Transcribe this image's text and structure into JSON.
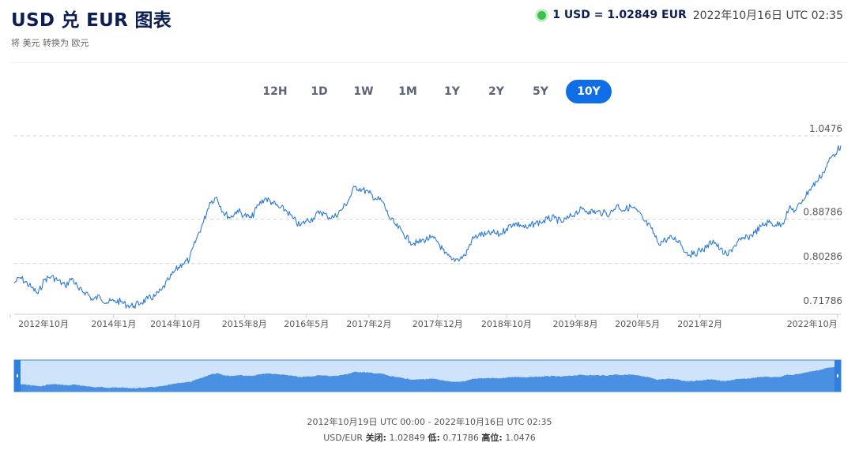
{
  "header": {
    "title": "USD 兑 EUR 图表",
    "subtitle": "将 美元 转换为 欧元",
    "rate": "1 USD = 1.02849 EUR",
    "timestamp": "2022年10月16日 UTC 02:35",
    "live_color": "#3ec14a"
  },
  "tabs": [
    "12H",
    "1D",
    "1W",
    "1M",
    "1Y",
    "2Y",
    "5Y",
    "10Y"
  ],
  "active_tab": "10Y",
  "footer": {
    "range": "2012年10月19日 UTC 00:00 - 2022年10月16日 UTC 02:35",
    "pair": "USD/EUR",
    "close_label": "关闭:",
    "close_value": "1.02849",
    "low_label": "低:",
    "low_value": "0.71786",
    "high_label": "高位:",
    "high_value": "1.0476"
  },
  "colors": {
    "line": "#2b7ad7",
    "navigator_fill": "#4a90e2",
    "navigator_bg": "#cfe3fb",
    "accent": "#0f6de8"
  },
  "chart_data": {
    "type": "line",
    "title": "",
    "xlabel": "",
    "ylabel": "",
    "ylim": [
      0.71786,
      1.0476
    ],
    "yticks": [
      0.71786,
      0.80286,
      0.88786,
      1.0476
    ],
    "ytick_labels": [
      "0.71786",
      "0.80286",
      "0.88786",
      "1.0476"
    ],
    "xlim": [
      "2012-10-19",
      "2022-10-16"
    ],
    "xticks": [
      "2012-10-01",
      "2014-01-01",
      "2014-10-01",
      "2015-08-01",
      "2016-05-01",
      "2017-02-01",
      "2017-12-01",
      "2018-10-01",
      "2019-08-01",
      "2020-05-01",
      "2021-02-01",
      "2022-10-01"
    ],
    "xtick_labels": [
      "2012年10月",
      "2014年1月",
      "2014年10月",
      "2015年8月",
      "2016年5月",
      "2017年2月",
      "2017年12月",
      "2018年10月",
      "2019年8月",
      "2020年5月",
      "2021年2月",
      "2022年10月"
    ],
    "grid": "horizontal dashed",
    "legend": "none",
    "series": [
      {
        "x": [
          "2012-10-19",
          "2012-11-15",
          "2013-01-01",
          "2013-02-01",
          "2013-03-01",
          "2013-04-01",
          "2013-05-01",
          "2013-06-01",
          "2013-07-01",
          "2013-08-01",
          "2013-09-01",
          "2013-10-01",
          "2013-11-01",
          "2013-12-01",
          "2014-01-01",
          "2014-02-01",
          "2014-03-01",
          "2014-04-01",
          "2014-05-01",
          "2014-06-01",
          "2014-07-01",
          "2014-08-01",
          "2014-09-01",
          "2014-10-01",
          "2014-11-01",
          "2014-12-01",
          "2015-01-01",
          "2015-02-01",
          "2015-03-01",
          "2015-04-01",
          "2015-05-01",
          "2015-06-01",
          "2015-07-01",
          "2015-08-01",
          "2015-09-01",
          "2015-10-01",
          "2015-11-01",
          "2015-12-01",
          "2016-01-01",
          "2016-02-01",
          "2016-03-01",
          "2016-04-01",
          "2016-05-01",
          "2016-06-01",
          "2016-07-01",
          "2016-08-01",
          "2016-09-01",
          "2016-10-01",
          "2016-11-01",
          "2016-12-01",
          "2017-01-01",
          "2017-02-01",
          "2017-03-01",
          "2017-04-01",
          "2017-05-01",
          "2017-06-01",
          "2017-07-01",
          "2017-08-01",
          "2017-09-01",
          "2017-10-01",
          "2017-11-01",
          "2017-12-01",
          "2018-01-01",
          "2018-02-01",
          "2018-03-01",
          "2018-04-01",
          "2018-05-01",
          "2018-06-01",
          "2018-07-01",
          "2018-08-01",
          "2018-09-01",
          "2018-10-01",
          "2018-11-01",
          "2018-12-01",
          "2019-01-01",
          "2019-02-01",
          "2019-03-01",
          "2019-04-01",
          "2019-05-01",
          "2019-06-01",
          "2019-07-01",
          "2019-08-01",
          "2019-09-01",
          "2019-10-01",
          "2019-11-01",
          "2019-12-01",
          "2020-01-01",
          "2020-02-01",
          "2020-03-01",
          "2020-04-01",
          "2020-05-01",
          "2020-06-01",
          "2020-07-01",
          "2020-08-01",
          "2020-09-01",
          "2020-10-01",
          "2020-11-01",
          "2020-12-01",
          "2021-01-01",
          "2021-02-01",
          "2021-03-01",
          "2021-04-01",
          "2021-05-01",
          "2021-06-01",
          "2021-07-01",
          "2021-08-01",
          "2021-09-01",
          "2021-10-01",
          "2021-11-01",
          "2021-12-01",
          "2022-01-01",
          "2022-02-01",
          "2022-03-01",
          "2022-04-01",
          "2022-05-01",
          "2022-06-01",
          "2022-07-01",
          "2022-08-01",
          "2022-09-01",
          "2022-10-01",
          "2022-10-16"
        ],
        "y": [
          0.766,
          0.776,
          0.758,
          0.745,
          0.772,
          0.778,
          0.77,
          0.76,
          0.775,
          0.752,
          0.748,
          0.733,
          0.74,
          0.728,
          0.731,
          0.73,
          0.723,
          0.722,
          0.728,
          0.735,
          0.74,
          0.752,
          0.772,
          0.79,
          0.803,
          0.81,
          0.85,
          0.882,
          0.92,
          0.93,
          0.9,
          0.891,
          0.905,
          0.895,
          0.89,
          0.915,
          0.928,
          0.92,
          0.91,
          0.905,
          0.89,
          0.875,
          0.885,
          0.89,
          0.903,
          0.893,
          0.892,
          0.905,
          0.923,
          0.95,
          0.945,
          0.938,
          0.928,
          0.922,
          0.892,
          0.875,
          0.862,
          0.845,
          0.842,
          0.848,
          0.852,
          0.845,
          0.822,
          0.81,
          0.812,
          0.818,
          0.848,
          0.858,
          0.858,
          0.862,
          0.858,
          0.87,
          0.88,
          0.877,
          0.87,
          0.88,
          0.882,
          0.888,
          0.89,
          0.882,
          0.89,
          0.9,
          0.907,
          0.903,
          0.902,
          0.9,
          0.898,
          0.915,
          0.905,
          0.912,
          0.903,
          0.884,
          0.87,
          0.842,
          0.848,
          0.852,
          0.847,
          0.824,
          0.82,
          0.828,
          0.833,
          0.848,
          0.83,
          0.818,
          0.836,
          0.848,
          0.853,
          0.862,
          0.875,
          0.882,
          0.877,
          0.88,
          0.908,
          0.905,
          0.925,
          0.945,
          0.96,
          0.978,
          1.005,
          1.02,
          1.029
        ]
      }
    ]
  }
}
